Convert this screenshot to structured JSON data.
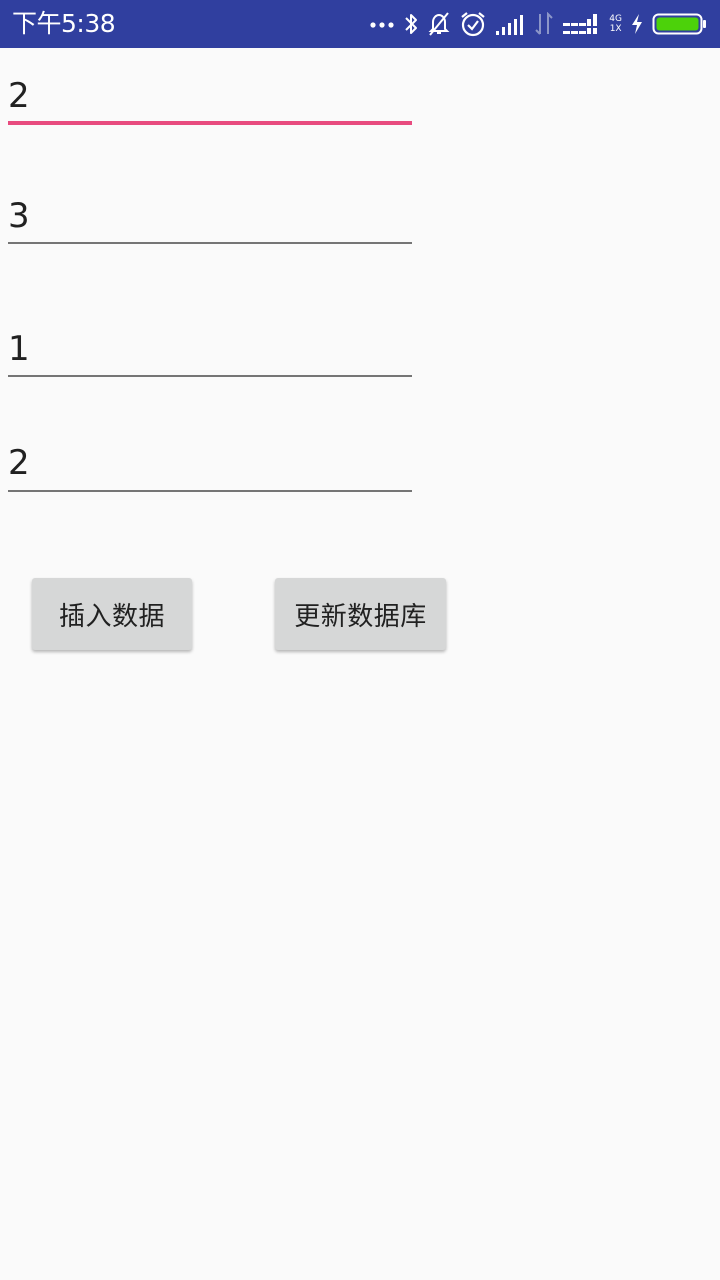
{
  "status_bar": {
    "time": "下午5:38",
    "network_top": "4G",
    "network_bottom": "1X",
    "icons": [
      "more-dots-icon",
      "bluetooth-icon",
      "notifications-off-icon",
      "alarm-icon",
      "signal-icon",
      "data-arrows-icon",
      "signal2-icon",
      "charging-icon",
      "battery-icon"
    ],
    "bar_color": "#303f9f",
    "battery_color": "#4cd20a"
  },
  "fields": [
    {
      "value": "2",
      "focused": true
    },
    {
      "value": "3",
      "focused": false
    },
    {
      "value": "1",
      "focused": false
    },
    {
      "value": "2",
      "focused": false
    }
  ],
  "buttons": {
    "insert_label": "插入数据",
    "update_label": "更新数据库"
  },
  "colors": {
    "accent": "#e84b7f",
    "background": "#fafafa"
  }
}
